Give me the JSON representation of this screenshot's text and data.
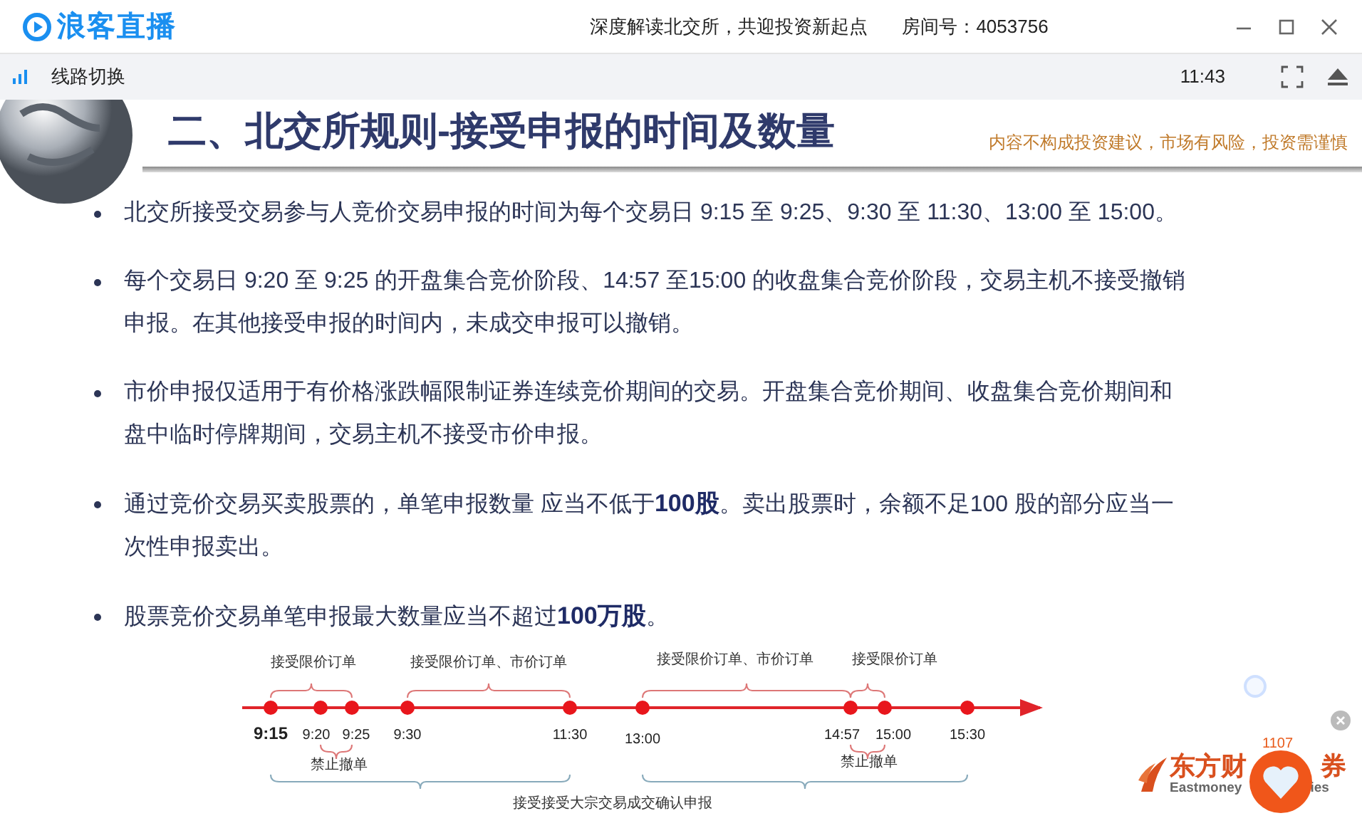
{
  "window": {
    "logo": "浪客直播",
    "title": "深度解读北交所，共迎投资新起点",
    "room": "房间号：4053756"
  },
  "toolbar": {
    "line_switch": "线路切换",
    "time": "11:43"
  },
  "slide": {
    "title": "二、北交所规则-接受申报的时间及数量",
    "disclaimer": "内容不构成投资建议，市场有风险，投资需谨慎",
    "bullets": [
      "北交所接受交易参与人竞价交易申报的时间为每个交易日 9:15 至 9:25、9:30 至 11:30、13:00 至 15:00。",
      "每个交易日 9:20 至 9:25 的开盘集合竞价阶段、14:57 至15:00 的收盘集合竞价阶段，交易主机不接受撤销申报。在其他接受申报的时间内，未成交申报可以撤销。",
      "市价申报仅适用于有价格涨跌幅限制证券连续竞价期间的交易。开盘集合竞价期间、收盘集合竞价期间和盘中临时停牌期间，交易主机不接受市价申报。",
      "通过竞价交易买卖股票的，单笔申报数量 应当不低于**100股**。卖出股票时，余额不足100 股的部分应当一次性申报卖出。",
      "股票竞价交易单笔申报最大数量应当不超过**100万股**。"
    ],
    "timeline": {
      "points": [
        "9:15",
        "9:20",
        "9:25",
        "9:30",
        "11:30",
        "13:00",
        "14:57",
        "15:00",
        "15:30"
      ],
      "top_labels": [
        "接受限价订单",
        "接受限价订单、市价订单",
        "接受限价订单、市价订单",
        "接受限价订单"
      ],
      "bottom_labels": [
        "禁止撤单",
        "禁止撤单"
      ],
      "span_label": "接受接受大宗交易成交确认申报"
    }
  },
  "overlay": {
    "likes": "1107",
    "sponsor": [
      "东方财",
      "券",
      "Eastmoney",
      "ies"
    ]
  }
}
